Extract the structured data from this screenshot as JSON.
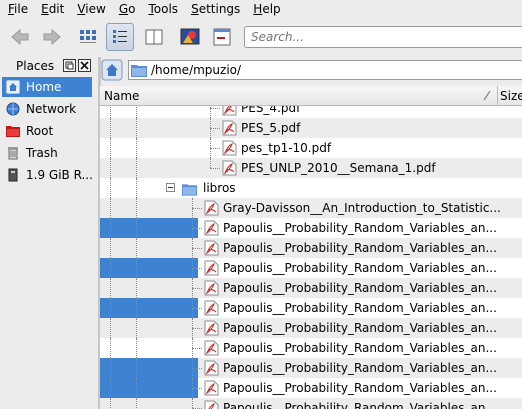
{
  "menubar": {
    "items": [
      {
        "mnemonic": "F",
        "rest": "ile"
      },
      {
        "mnemonic": "E",
        "rest": "dit"
      },
      {
        "mnemonic": "V",
        "rest": "iew"
      },
      {
        "mnemonic": "G",
        "rest": "o"
      },
      {
        "mnemonic": "T",
        "rest": "ools"
      },
      {
        "mnemonic": "S",
        "rest": "ettings"
      },
      {
        "mnemonic": "H",
        "rest": "elp"
      }
    ]
  },
  "toolbar": {
    "buttons": [
      {
        "name": "back-button",
        "icon": "arrow-left-icon"
      },
      {
        "name": "forward-button",
        "icon": "arrow-right-icon"
      },
      {
        "name": "icon-view-button",
        "icon": "icon-view-icon"
      },
      {
        "name": "detail-view-button",
        "icon": "detail-view-icon",
        "active": true
      },
      {
        "name": "compact-view-button",
        "icon": "compact-view-icon"
      },
      {
        "name": "preview-button",
        "icon": "preview-icon"
      },
      {
        "name": "split-button",
        "icon": "split-icon"
      }
    ],
    "search_placeholder": "Search..."
  },
  "sidebar": {
    "title": "Places",
    "items": [
      {
        "label": "Home",
        "icon": "home-icon",
        "selected": true
      },
      {
        "label": "Network",
        "icon": "network-icon"
      },
      {
        "label": "Root",
        "icon": "root-folder-icon"
      },
      {
        "label": "Trash",
        "icon": "trash-icon"
      },
      {
        "label": "1.9 GiB R...",
        "icon": "drive-icon"
      }
    ]
  },
  "location": {
    "path": "/home/mpuzio/"
  },
  "columns": {
    "name": "Name",
    "size": "Size"
  },
  "files": [
    {
      "name": "PES_4.pdf",
      "type": "pdf",
      "depth": 2,
      "partial": true
    },
    {
      "name": "PES_5.pdf",
      "type": "pdf",
      "depth": 2
    },
    {
      "name": "pes_tp1-10.pdf",
      "type": "pdf",
      "depth": 2
    },
    {
      "name": "PES_UNLP_2010__Semana_1.pdf",
      "type": "pdf",
      "depth": 2,
      "last": true
    },
    {
      "name": "libros",
      "type": "folder",
      "depth": 1,
      "expanded": true
    },
    {
      "name": "Gray-Davisson__An_Introduction_to_Statistic...",
      "type": "pdf",
      "depth": 2
    },
    {
      "name": "Papoulis__Probability_Random_Variables_an...",
      "type": "pdf",
      "depth": 2,
      "selected": true
    },
    {
      "name": "Papoulis__Probability_Random_Variables_an...",
      "type": "pdf",
      "depth": 2
    },
    {
      "name": "Papoulis__Probability_Random_Variables_an...",
      "type": "pdf",
      "depth": 2,
      "selected": true
    },
    {
      "name": "Papoulis__Probability_Random_Variables_an...",
      "type": "pdf",
      "depth": 2
    },
    {
      "name": "Papoulis__Probability_Random_Variables_an...",
      "type": "pdf",
      "depth": 2,
      "selected": true
    },
    {
      "name": "Papoulis__Probability_Random_Variables_an...",
      "type": "pdf",
      "depth": 2
    },
    {
      "name": "Papoulis__Probability_Random_Variables_an...",
      "type": "pdf",
      "depth": 2
    },
    {
      "name": "Papoulis__Probability_Random_Variables_an...",
      "type": "pdf",
      "depth": 2,
      "selected": true
    },
    {
      "name": "Papoulis__Probability_Random_Variables_an...",
      "type": "pdf",
      "depth": 2,
      "selected": true
    },
    {
      "name": "Papoulis__Probability_Random_Variables_an...",
      "type": "pdf",
      "depth": 2,
      "partial": true
    }
  ],
  "colors": {
    "selection": "#3d83d1",
    "alt_row": "#ececec",
    "pdf_red": "#cc2a2a",
    "folder_blue": "#6a9fd8"
  }
}
